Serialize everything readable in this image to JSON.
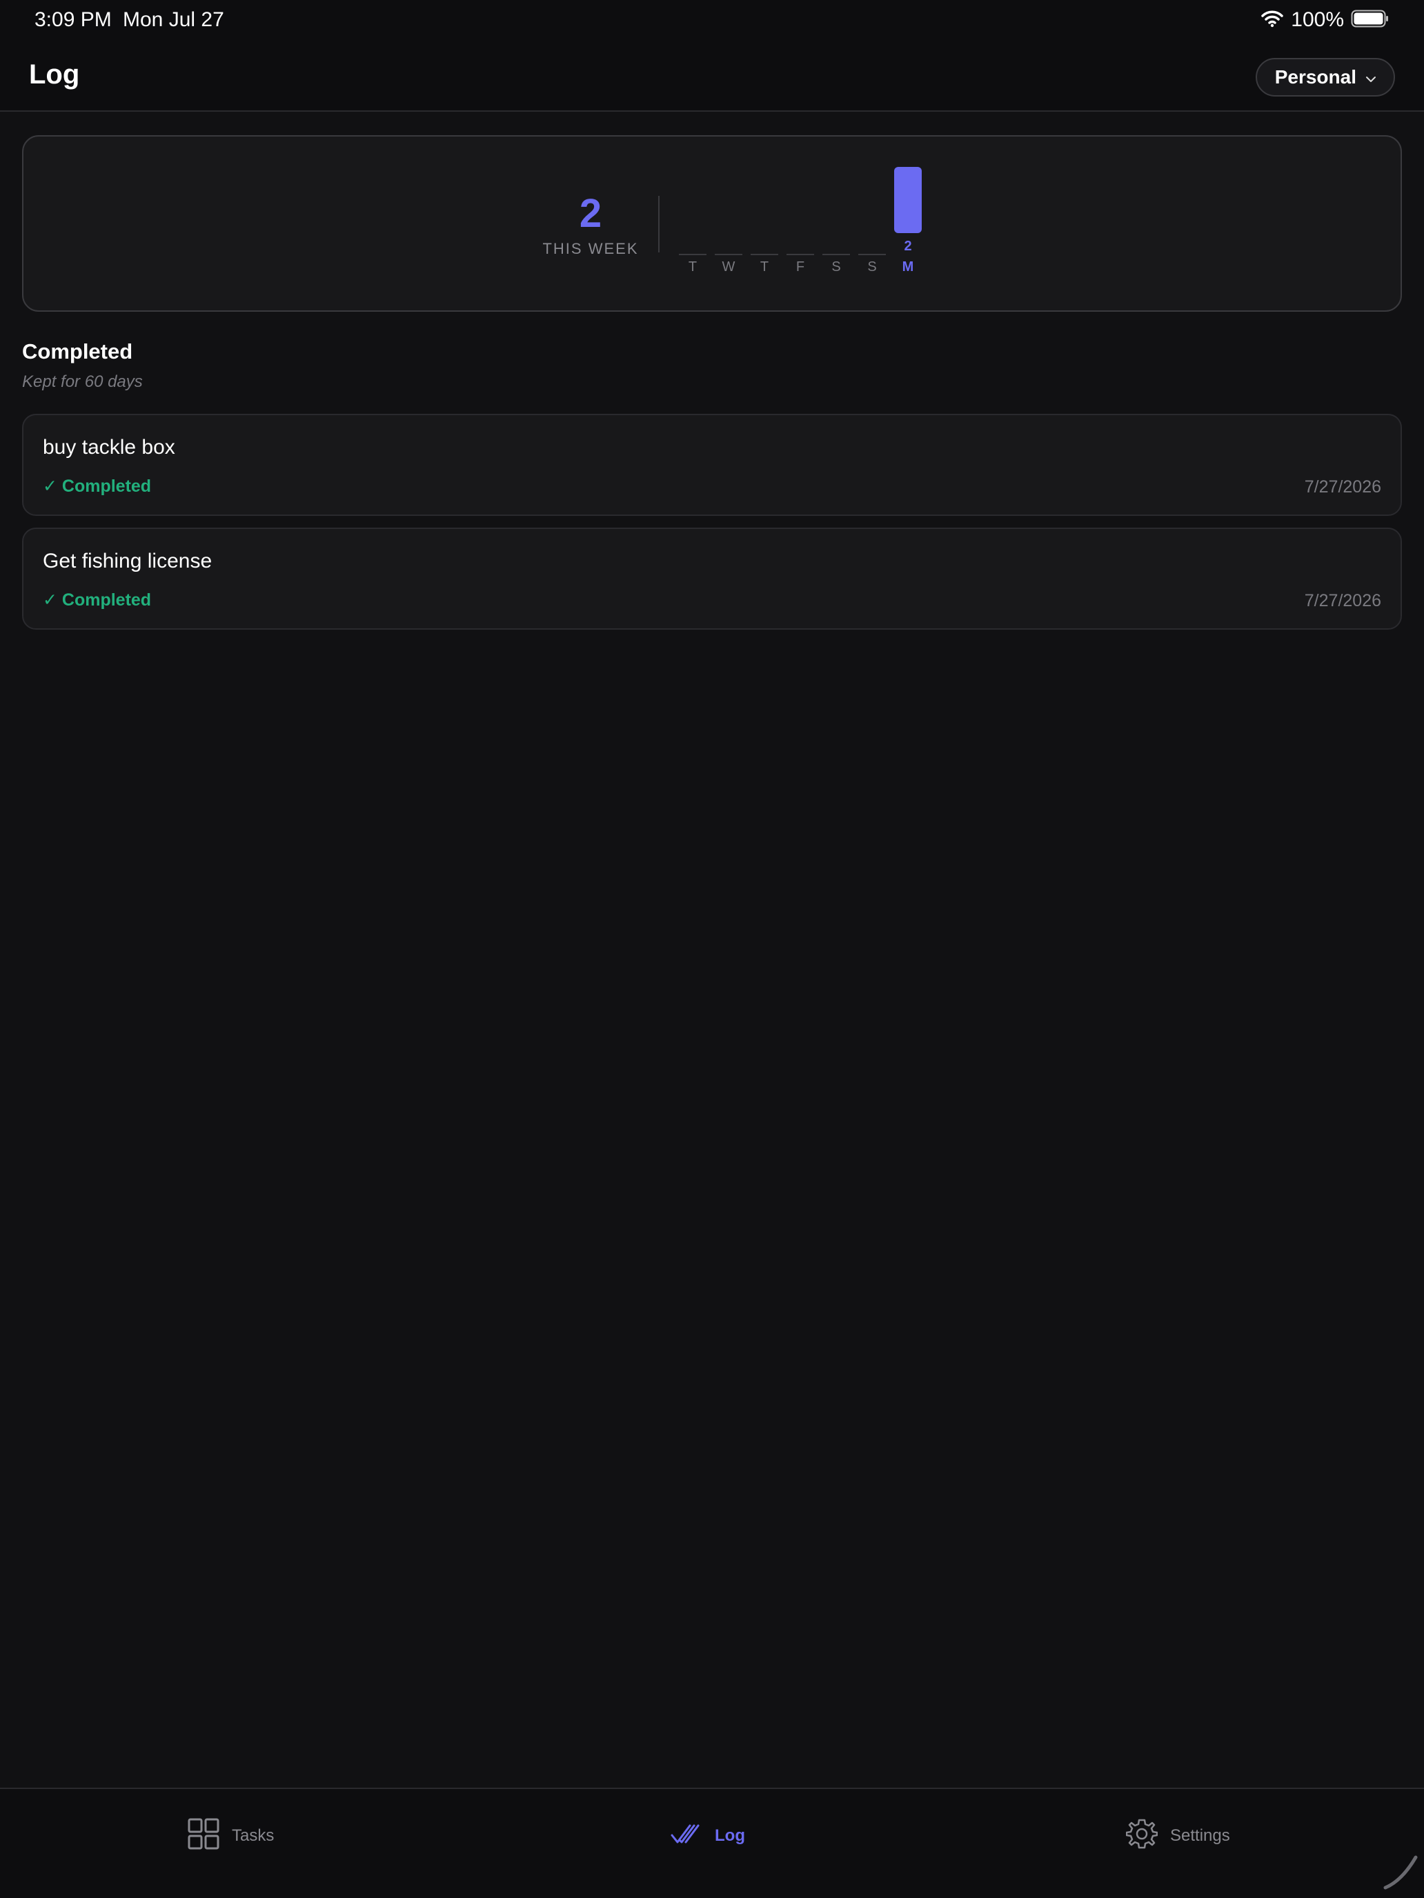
{
  "status_bar": {
    "time": "3:09 PM",
    "date": "Mon Jul 27",
    "battery": "100%"
  },
  "header": {
    "title": "Log",
    "workspace": "Personal"
  },
  "stats": {
    "count": "2",
    "label": "THIS WEEK",
    "days": [
      {
        "day": "T",
        "count": 0
      },
      {
        "day": "W",
        "count": 0
      },
      {
        "day": "T",
        "count": 0
      },
      {
        "day": "F",
        "count": 0
      },
      {
        "day": "S",
        "count": 0
      },
      {
        "day": "S",
        "count": 0
      },
      {
        "day": "M",
        "count": 2,
        "active": true
      }
    ]
  },
  "chart_data": {
    "type": "bar",
    "categories": [
      "T",
      "W",
      "T",
      "F",
      "S",
      "S",
      "M"
    ],
    "values": [
      0,
      0,
      0,
      0,
      0,
      0,
      2
    ]
  },
  "completed": {
    "title": "Completed",
    "subtitle": "Kept for 60 days",
    "items": [
      {
        "title": "buy tackle box",
        "status": "✓ Completed",
        "date": "7/27/2026"
      },
      {
        "title": "Get fishing license",
        "status": "✓ Completed",
        "date": "7/27/2026"
      }
    ]
  },
  "tabs": [
    {
      "label": "Tasks",
      "icon": "grid-icon"
    },
    {
      "label": "Log",
      "icon": "double-check-icon",
      "active": true
    },
    {
      "label": "Settings",
      "icon": "gear-icon"
    }
  ],
  "colors": {
    "accent": "#6b6bf2",
    "success": "#22b07d",
    "background": "#111113"
  }
}
